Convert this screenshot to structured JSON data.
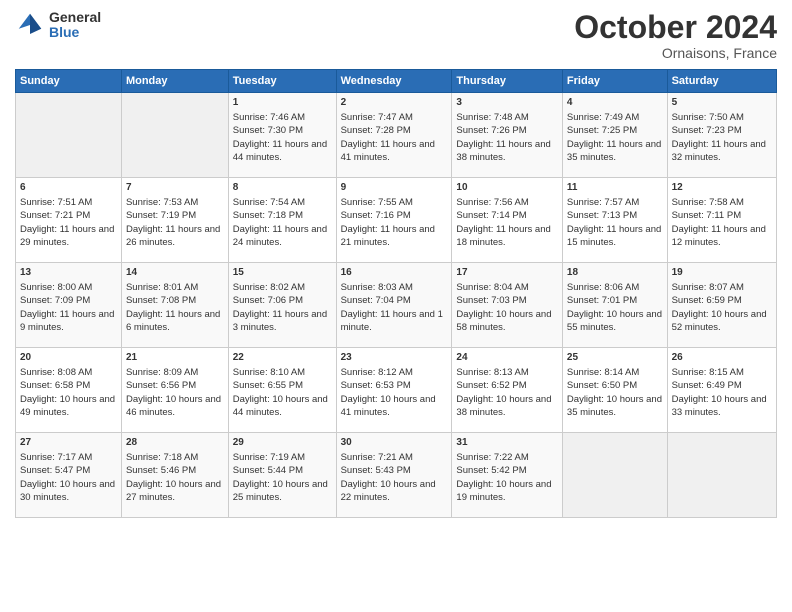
{
  "header": {
    "logo_general": "General",
    "logo_blue": "Blue",
    "month": "October 2024",
    "location": "Ornaisons, France"
  },
  "days_of_week": [
    "Sunday",
    "Monday",
    "Tuesday",
    "Wednesday",
    "Thursday",
    "Friday",
    "Saturday"
  ],
  "weeks": [
    [
      {
        "day": "",
        "sunrise": "",
        "sunset": "",
        "daylight": ""
      },
      {
        "day": "",
        "sunrise": "",
        "sunset": "",
        "daylight": ""
      },
      {
        "day": "1",
        "sunrise": "Sunrise: 7:46 AM",
        "sunset": "Sunset: 7:30 PM",
        "daylight": "Daylight: 11 hours and 44 minutes."
      },
      {
        "day": "2",
        "sunrise": "Sunrise: 7:47 AM",
        "sunset": "Sunset: 7:28 PM",
        "daylight": "Daylight: 11 hours and 41 minutes."
      },
      {
        "day": "3",
        "sunrise": "Sunrise: 7:48 AM",
        "sunset": "Sunset: 7:26 PM",
        "daylight": "Daylight: 11 hours and 38 minutes."
      },
      {
        "day": "4",
        "sunrise": "Sunrise: 7:49 AM",
        "sunset": "Sunset: 7:25 PM",
        "daylight": "Daylight: 11 hours and 35 minutes."
      },
      {
        "day": "5",
        "sunrise": "Sunrise: 7:50 AM",
        "sunset": "Sunset: 7:23 PM",
        "daylight": "Daylight: 11 hours and 32 minutes."
      }
    ],
    [
      {
        "day": "6",
        "sunrise": "Sunrise: 7:51 AM",
        "sunset": "Sunset: 7:21 PM",
        "daylight": "Daylight: 11 hours and 29 minutes."
      },
      {
        "day": "7",
        "sunrise": "Sunrise: 7:53 AM",
        "sunset": "Sunset: 7:19 PM",
        "daylight": "Daylight: 11 hours and 26 minutes."
      },
      {
        "day": "8",
        "sunrise": "Sunrise: 7:54 AM",
        "sunset": "Sunset: 7:18 PM",
        "daylight": "Daylight: 11 hours and 24 minutes."
      },
      {
        "day": "9",
        "sunrise": "Sunrise: 7:55 AM",
        "sunset": "Sunset: 7:16 PM",
        "daylight": "Daylight: 11 hours and 21 minutes."
      },
      {
        "day": "10",
        "sunrise": "Sunrise: 7:56 AM",
        "sunset": "Sunset: 7:14 PM",
        "daylight": "Daylight: 11 hours and 18 minutes."
      },
      {
        "day": "11",
        "sunrise": "Sunrise: 7:57 AM",
        "sunset": "Sunset: 7:13 PM",
        "daylight": "Daylight: 11 hours and 15 minutes."
      },
      {
        "day": "12",
        "sunrise": "Sunrise: 7:58 AM",
        "sunset": "Sunset: 7:11 PM",
        "daylight": "Daylight: 11 hours and 12 minutes."
      }
    ],
    [
      {
        "day": "13",
        "sunrise": "Sunrise: 8:00 AM",
        "sunset": "Sunset: 7:09 PM",
        "daylight": "Daylight: 11 hours and 9 minutes."
      },
      {
        "day": "14",
        "sunrise": "Sunrise: 8:01 AM",
        "sunset": "Sunset: 7:08 PM",
        "daylight": "Daylight: 11 hours and 6 minutes."
      },
      {
        "day": "15",
        "sunrise": "Sunrise: 8:02 AM",
        "sunset": "Sunset: 7:06 PM",
        "daylight": "Daylight: 11 hours and 3 minutes."
      },
      {
        "day": "16",
        "sunrise": "Sunrise: 8:03 AM",
        "sunset": "Sunset: 7:04 PM",
        "daylight": "Daylight: 11 hours and 1 minute."
      },
      {
        "day": "17",
        "sunrise": "Sunrise: 8:04 AM",
        "sunset": "Sunset: 7:03 PM",
        "daylight": "Daylight: 10 hours and 58 minutes."
      },
      {
        "day": "18",
        "sunrise": "Sunrise: 8:06 AM",
        "sunset": "Sunset: 7:01 PM",
        "daylight": "Daylight: 10 hours and 55 minutes."
      },
      {
        "day": "19",
        "sunrise": "Sunrise: 8:07 AM",
        "sunset": "Sunset: 6:59 PM",
        "daylight": "Daylight: 10 hours and 52 minutes."
      }
    ],
    [
      {
        "day": "20",
        "sunrise": "Sunrise: 8:08 AM",
        "sunset": "Sunset: 6:58 PM",
        "daylight": "Daylight: 10 hours and 49 minutes."
      },
      {
        "day": "21",
        "sunrise": "Sunrise: 8:09 AM",
        "sunset": "Sunset: 6:56 PM",
        "daylight": "Daylight: 10 hours and 46 minutes."
      },
      {
        "day": "22",
        "sunrise": "Sunrise: 8:10 AM",
        "sunset": "Sunset: 6:55 PM",
        "daylight": "Daylight: 10 hours and 44 minutes."
      },
      {
        "day": "23",
        "sunrise": "Sunrise: 8:12 AM",
        "sunset": "Sunset: 6:53 PM",
        "daylight": "Daylight: 10 hours and 41 minutes."
      },
      {
        "day": "24",
        "sunrise": "Sunrise: 8:13 AM",
        "sunset": "Sunset: 6:52 PM",
        "daylight": "Daylight: 10 hours and 38 minutes."
      },
      {
        "day": "25",
        "sunrise": "Sunrise: 8:14 AM",
        "sunset": "Sunset: 6:50 PM",
        "daylight": "Daylight: 10 hours and 35 minutes."
      },
      {
        "day": "26",
        "sunrise": "Sunrise: 8:15 AM",
        "sunset": "Sunset: 6:49 PM",
        "daylight": "Daylight: 10 hours and 33 minutes."
      }
    ],
    [
      {
        "day": "27",
        "sunrise": "Sunrise: 7:17 AM",
        "sunset": "Sunset: 5:47 PM",
        "daylight": "Daylight: 10 hours and 30 minutes."
      },
      {
        "day": "28",
        "sunrise": "Sunrise: 7:18 AM",
        "sunset": "Sunset: 5:46 PM",
        "daylight": "Daylight: 10 hours and 27 minutes."
      },
      {
        "day": "29",
        "sunrise": "Sunrise: 7:19 AM",
        "sunset": "Sunset: 5:44 PM",
        "daylight": "Daylight: 10 hours and 25 minutes."
      },
      {
        "day": "30",
        "sunrise": "Sunrise: 7:21 AM",
        "sunset": "Sunset: 5:43 PM",
        "daylight": "Daylight: 10 hours and 22 minutes."
      },
      {
        "day": "31",
        "sunrise": "Sunrise: 7:22 AM",
        "sunset": "Sunset: 5:42 PM",
        "daylight": "Daylight: 10 hours and 19 minutes."
      },
      {
        "day": "",
        "sunrise": "",
        "sunset": "",
        "daylight": ""
      },
      {
        "day": "",
        "sunrise": "",
        "sunset": "",
        "daylight": ""
      }
    ]
  ]
}
